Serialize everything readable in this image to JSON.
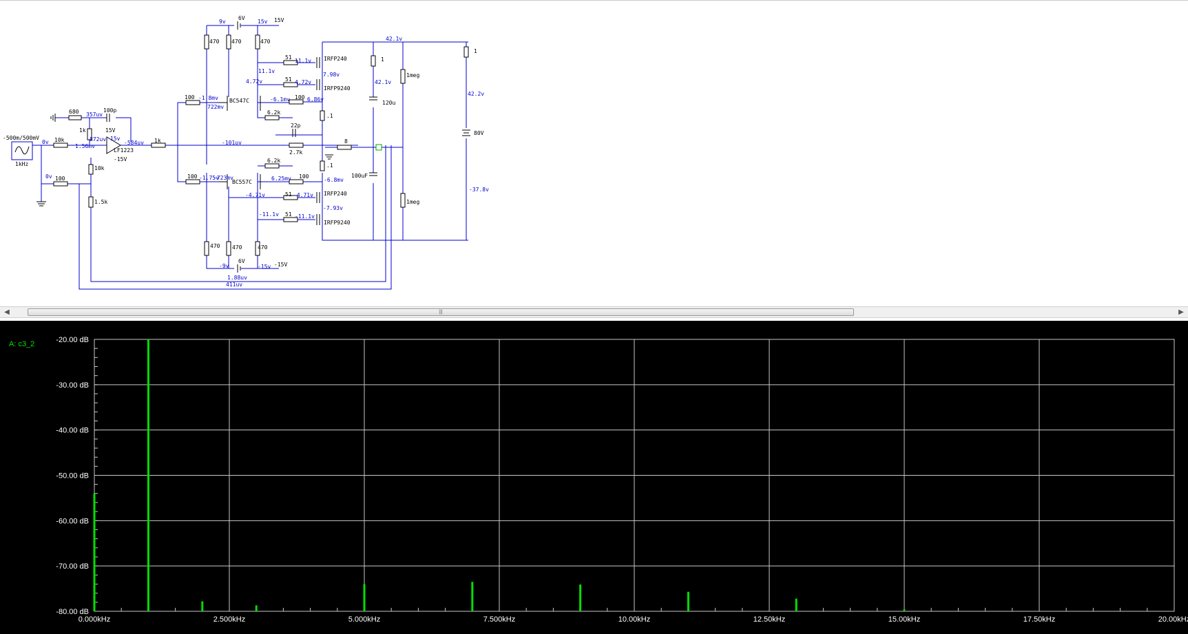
{
  "schematic": {
    "source": {
      "label": "-500m/500mV",
      "freq": "1kHz",
      "out_v": "0v"
    },
    "components": {
      "r680": "680",
      "r10k_in": "10k",
      "r10k_fb": "10k",
      "r100_gnd": "100",
      "r1k_opamp": "1k",
      "r1k5": "1.5k",
      "c100p": "100p",
      "opamp": "LF1223",
      "r1k_out": "1k",
      "r100_upper": "100",
      "r100_lower": "100",
      "q_npn": "BC547C",
      "q_pnp": "BC557C",
      "r470_1": "470",
      "r470_2": "470",
      "r470_3": "470",
      "r470_4": "470",
      "r470_5": "470",
      "r470_6": "470",
      "r6k2_upper": "6.2k",
      "r6k2_lower": "6.2k",
      "r51_1": "51",
      "r51_2": "51",
      "r51_3": "51",
      "r51_4": "51",
      "r100_bias_up": "100",
      "r100_bias_lo": "100",
      "m1": "IRFP240",
      "m2": "IRFP9240",
      "m3": "IRFP240",
      "m4": "IRFP9240",
      "c22p": "22p",
      "r2k7": "2.7k",
      "r8": "8",
      "r01_up": ".1",
      "r01_lo": ".1",
      "r1_up": "1",
      "c120u": "120u",
      "c100uf": "100uF",
      "r1meg_up": "1meg",
      "r1meg_lo": "1meg",
      "r1_right": "1",
      "bat80": "80V",
      "bat6v_up": "6V",
      "bat6v_lo": "6V",
      "vcc_up": "15V",
      "vcc_lo": "-15V",
      "op_vcc": "15V",
      "op_vee": "-15V"
    },
    "voltages": {
      "v357": "357uv",
      "v1_56": "1.56mv",
      "v872": "872uv",
      "v15": "15v",
      "v_out_op": "-584uv",
      "v_m1_8": "-1.8mv",
      "v722": "722mv",
      "v4_72": "4.72v",
      "v11_1": "11.1v",
      "v11_1g": "11.1v",
      "v4_72g": "4.72v",
      "v7_98": "7.98v",
      "v_6_1": "-6.1mv",
      "v6_86": "6.86v",
      "v_101": "-101uv",
      "v42_1_top": "42.1v",
      "v42_1": "42.1v",
      "v42_2": "42.2v",
      "v_37_8": "-37.8v",
      "v_m1_75": "-1.75v",
      "v_m723": "-723mv",
      "v6_25": "6.25mv",
      "v_6_8": "-6.8mv",
      "v_4_71": "-4.71v",
      "v_4_71g": "-4.71v",
      "v_7_93": "-7.93v",
      "v_11_1": "-11.1v",
      "v_11_1g": "-11.1v",
      "v9_top": "9v",
      "v15_top": "15v",
      "v_9_bot": "-9v",
      "v_15_bot": "-15v",
      "v1_88": "1.88uv",
      "v411": "411uv",
      "v0_gnd": "0v",
      "v_m15op": "-15V"
    },
    "colors": {
      "wire": "#0000cc",
      "component": "#000000"
    }
  },
  "scrollbar": {
    "left_icon": "◀",
    "right_icon": "▶",
    "grip": "|||"
  },
  "analyzer": {
    "trace_label": "A: c3_2",
    "trace_color": "#00e000",
    "background": "#000000",
    "grid_color": "#c8c8c8"
  },
  "chart_data": {
    "type": "bar",
    "title": "",
    "trace_name": "A: c3_2",
    "x_unit": "kHz",
    "y_unit": "dB",
    "xlim": [
      0,
      20
    ],
    "ylim": [
      -80,
      -20
    ],
    "grid": true,
    "x_ticks": [
      "0.000kHz",
      "2.500kHz",
      "5.000kHz",
      "7.500kHz",
      "10.00kHz",
      "12.50kHz",
      "15.00kHz",
      "17.50kHz",
      "20.00kHz"
    ],
    "y_ticks": [
      "-20.00 dB",
      "-30.00 dB",
      "-40.00 dB",
      "-50.00 dB",
      "-60.00 dB",
      "-70.00 dB",
      "-80.00 dB"
    ],
    "x": [
      0,
      1,
      2,
      3,
      5,
      7,
      9,
      11,
      13,
      15
    ],
    "values": [
      -54,
      -20,
      -77.8,
      -78.7,
      -74,
      -73.5,
      -74.1,
      -75.7,
      -77.2,
      -79.6
    ]
  }
}
